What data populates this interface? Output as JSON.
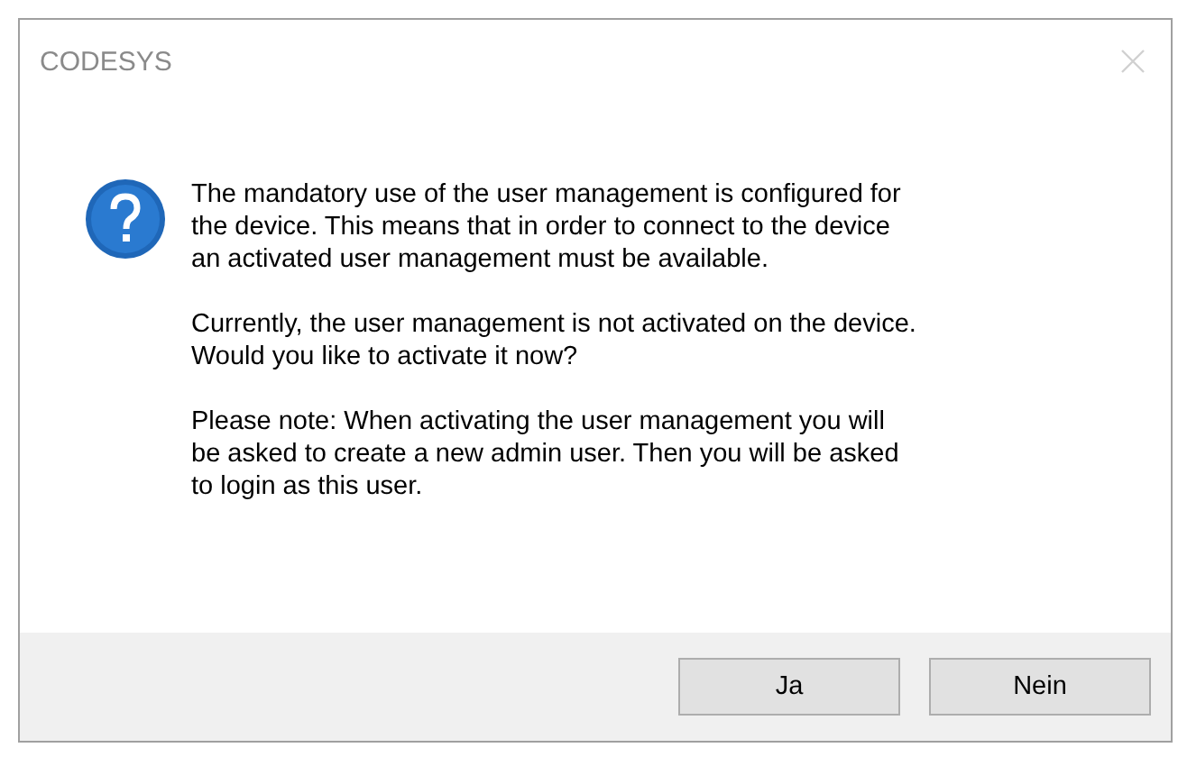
{
  "window": {
    "title": "CODESYS",
    "close_disabled": true
  },
  "message": {
    "paragraphs": [
      "The mandatory use of the user management is configured for\nthe device. This means that in order to connect to the device\nan activated user management must be available.",
      "Currently, the user management is not activated on the device.\nWould you like to activate it now?",
      "Please note: When activating the user management you will\nbe asked to create a new admin user. Then you will be asked\nto login as this user."
    ]
  },
  "buttons": [
    {
      "label": "Ja"
    },
    {
      "label": "Nein"
    }
  ]
}
